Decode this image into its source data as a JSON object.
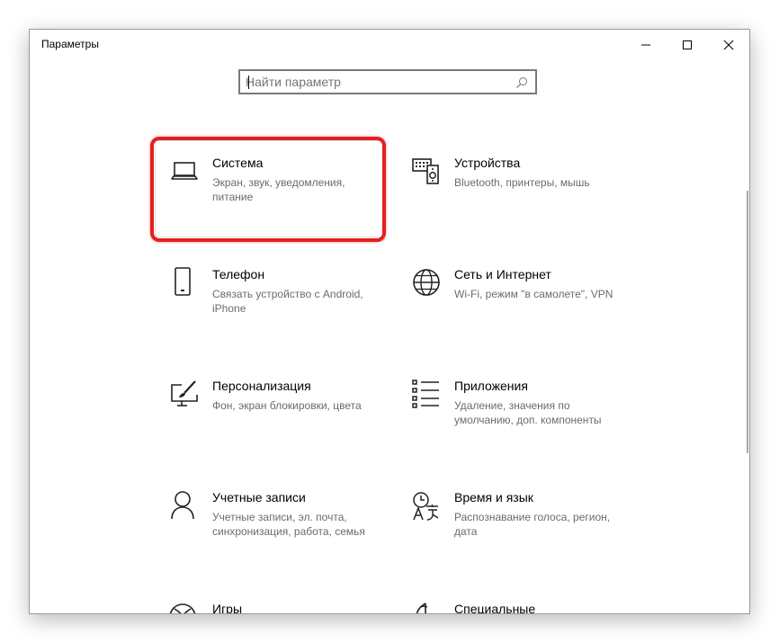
{
  "window": {
    "title": "Параметры"
  },
  "controls": {
    "minimize": "minimize",
    "maximize": "maximize",
    "close": "close"
  },
  "search": {
    "placeholder": "Найти параметр",
    "value": ""
  },
  "categories": [
    {
      "name": "Система",
      "desc": "Экран, звук, уведомления, питание",
      "icon": "laptop-icon",
      "highlighted": true
    },
    {
      "name": "Устройства",
      "desc": "Bluetooth, принтеры, мышь",
      "icon": "devices-icon"
    },
    {
      "name": "Телефон",
      "desc": "Связать устройство с Android, iPhone",
      "icon": "phone-icon"
    },
    {
      "name": "Сеть и Интернет",
      "desc": "Wi-Fi, режим \"в самолете\", VPN",
      "icon": "globe-icon"
    },
    {
      "name": "Персонализация",
      "desc": "Фон, экран блокировки, цвета",
      "icon": "paintbrush-icon"
    },
    {
      "name": "Приложения",
      "desc": "Удаление, значения по умолчанию, доп. компоненты",
      "icon": "apps-list-icon"
    },
    {
      "name": "Учетные записи",
      "desc": "Учетные записи, эл. почта, синхронизация, работа, семья",
      "icon": "person-icon"
    },
    {
      "name": "Время и язык",
      "desc": "Распознавание голоса, регион, дата",
      "icon": "time-language-icon"
    },
    {
      "name": "Игры",
      "desc": "",
      "icon": "xbox-icon"
    },
    {
      "name": "Специальные",
      "desc": "",
      "icon": "accessibility-icon"
    }
  ],
  "colors": {
    "highlight": "#e32020",
    "text": "#000000",
    "secondary_text": "#6b6b6b"
  }
}
